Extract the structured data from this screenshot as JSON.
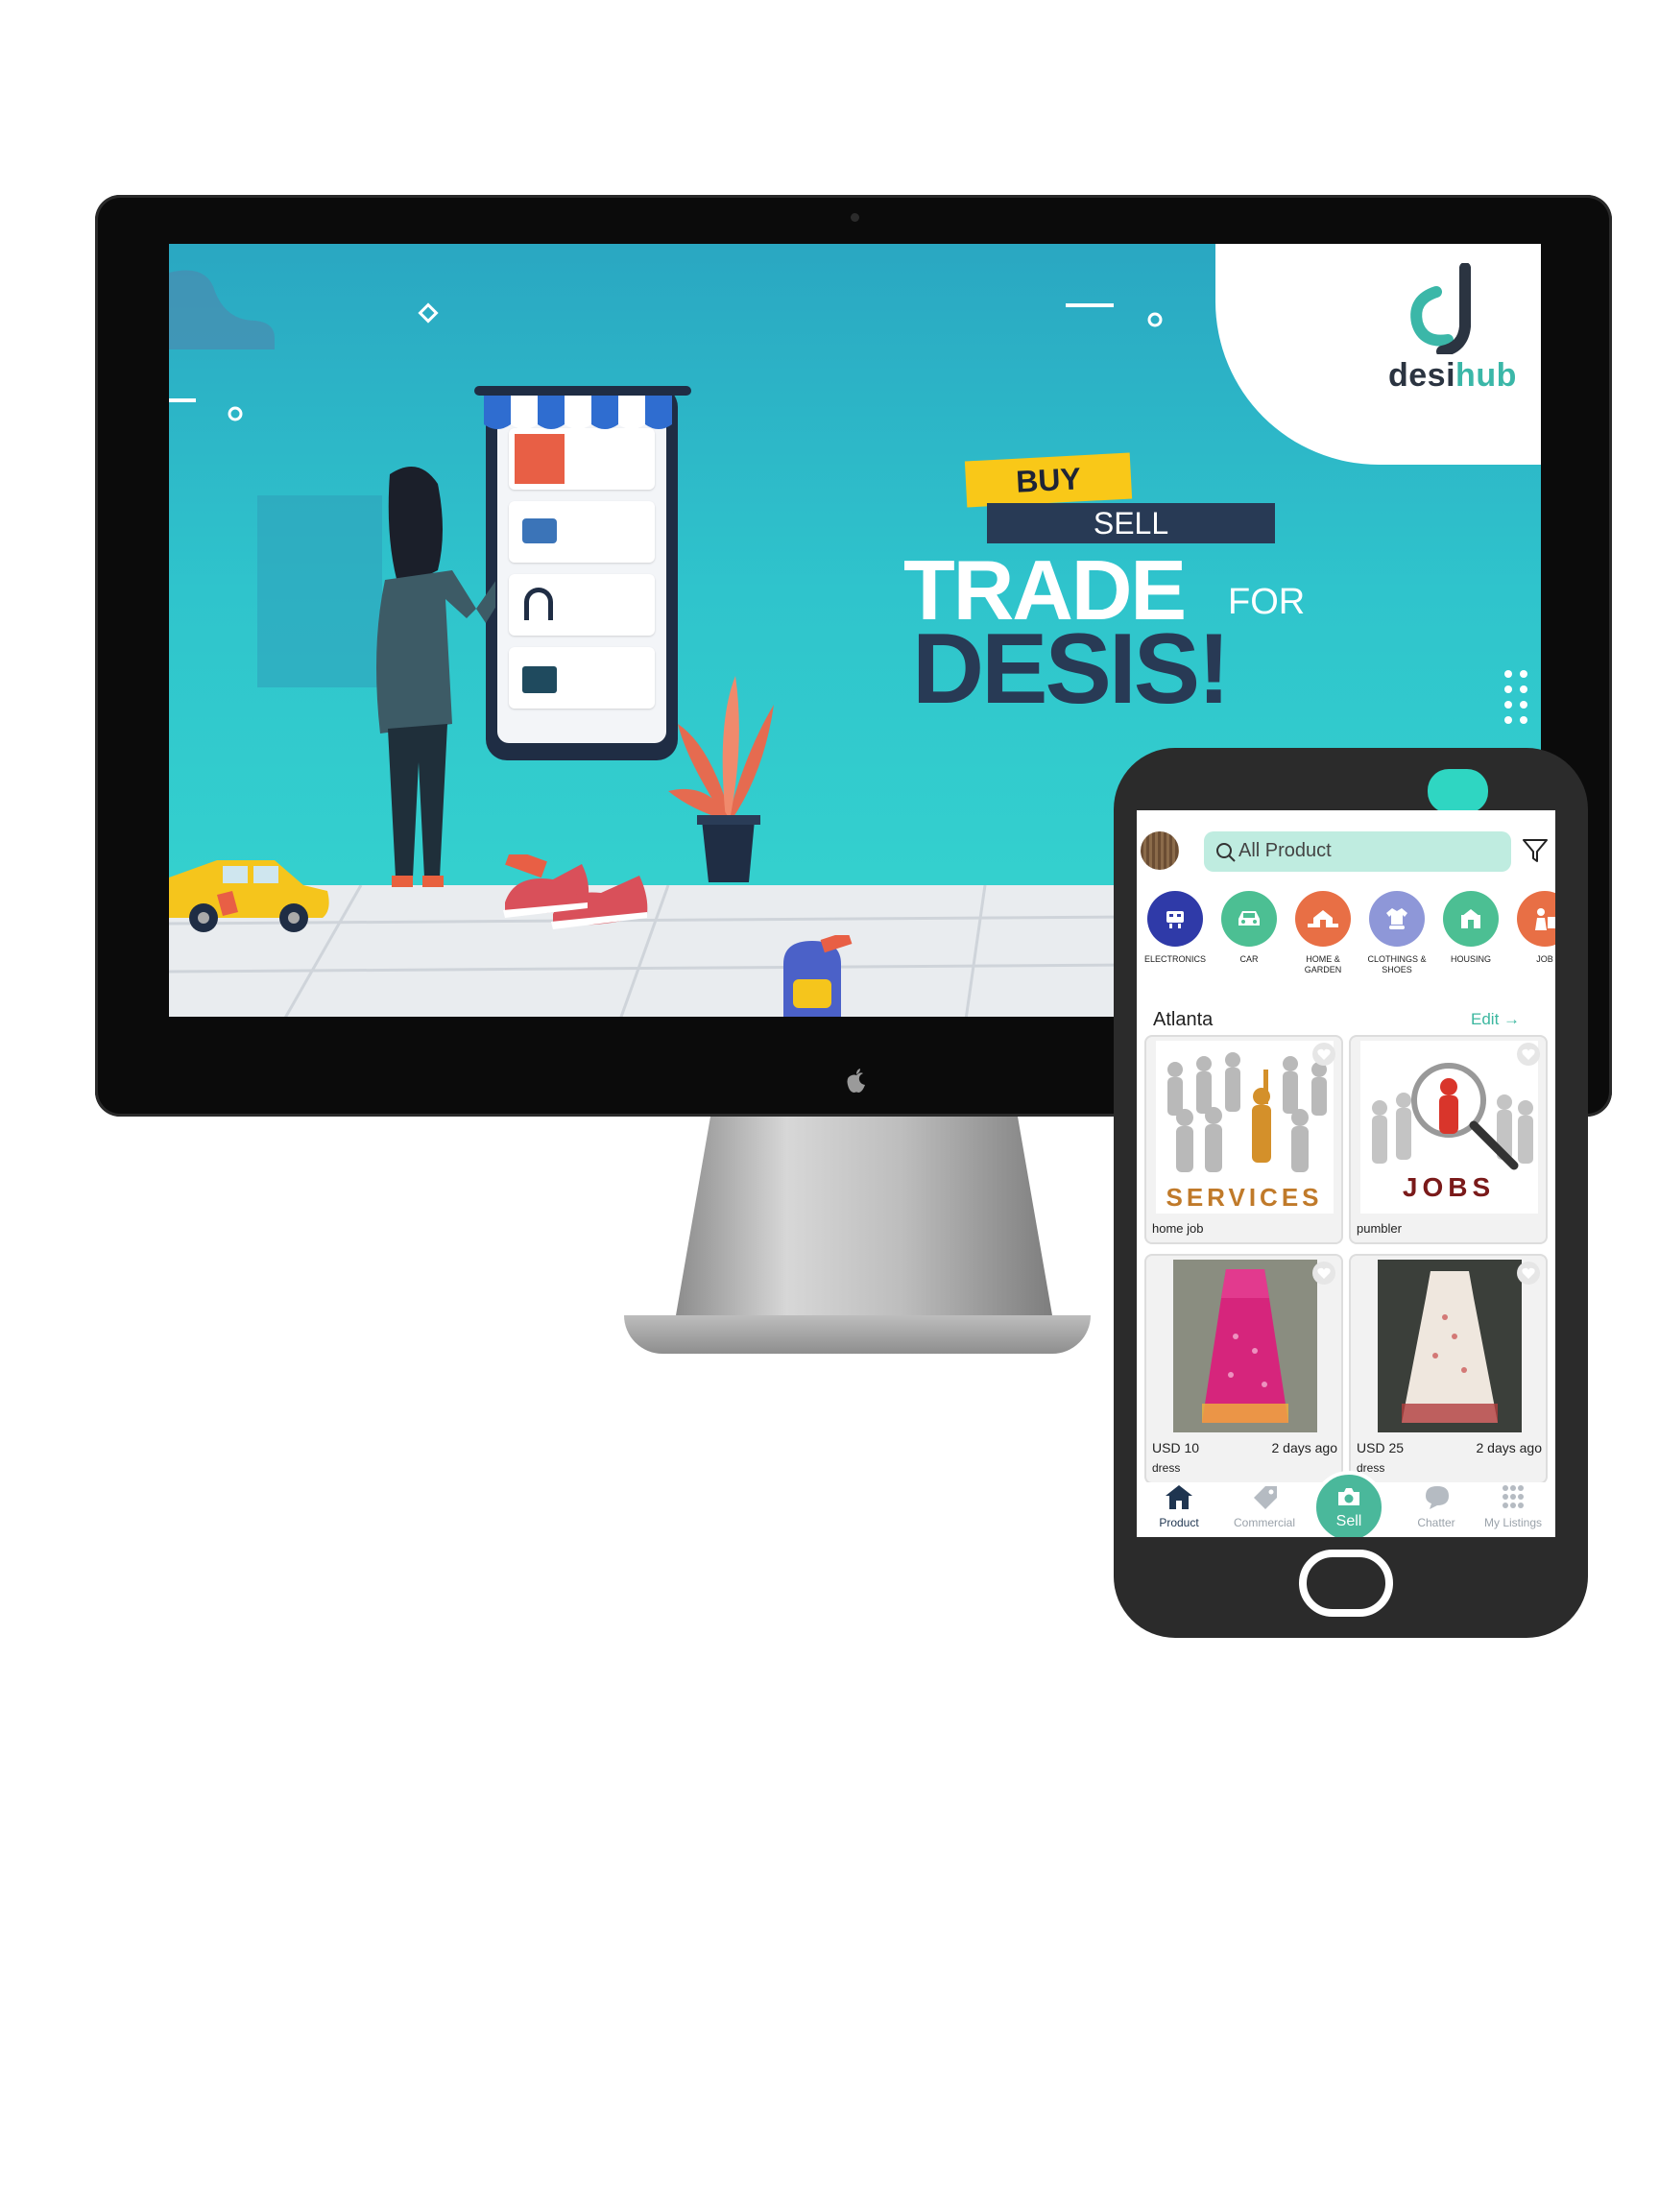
{
  "banner": {
    "logo": "desihub",
    "headline_buy": "BUY",
    "headline_sell": "SELL",
    "headline_trade": "TRADE",
    "headline_for": "FOR",
    "headline_desis": "DESIS!"
  },
  "app": {
    "search": {
      "placeholder": "All Product"
    },
    "categories": [
      {
        "label": "ELECTRONICS",
        "icon": "electronics-icon",
        "color": "#2f3aa8"
      },
      {
        "label": "CAR",
        "icon": "car-icon",
        "color": "#4cbf93"
      },
      {
        "label": "HOME & GARDEN",
        "icon": "home-garden-icon",
        "color": "#e86f45"
      },
      {
        "label": "CLOTHINGS & SHOES",
        "icon": "clothing-icon",
        "color": "#8e97d8"
      },
      {
        "label": "HOUSING",
        "icon": "housing-icon",
        "color": "#4cbf93"
      },
      {
        "label": "JOB",
        "icon": "job-icon",
        "color": "#e86f45"
      }
    ],
    "location": "Atlanta",
    "edit_label": "Edit",
    "listings": [
      {
        "title": "home job",
        "image_text": "SERVICES"
      },
      {
        "title": "pumbler",
        "image_text": "JOBS"
      },
      {
        "price": "USD 10",
        "age": "2 days ago",
        "title": "dress"
      },
      {
        "price": "USD 25",
        "age": "2 days ago",
        "title": "dress"
      }
    ],
    "nav": [
      {
        "label": "Product",
        "icon": "home-icon",
        "active": true
      },
      {
        "label": "Commercial",
        "icon": "tag-icon"
      },
      {
        "label": "Sell",
        "icon": "camera-icon"
      },
      {
        "label": "Chatter",
        "icon": "chat-icon"
      },
      {
        "label": "My Listings",
        "icon": "grid-icon"
      }
    ]
  },
  "colors": {
    "accent": "#3bb79f",
    "search_bg": "#bfece0",
    "banner_navy": "#283a55",
    "banner_yellow": "#f9c818"
  }
}
